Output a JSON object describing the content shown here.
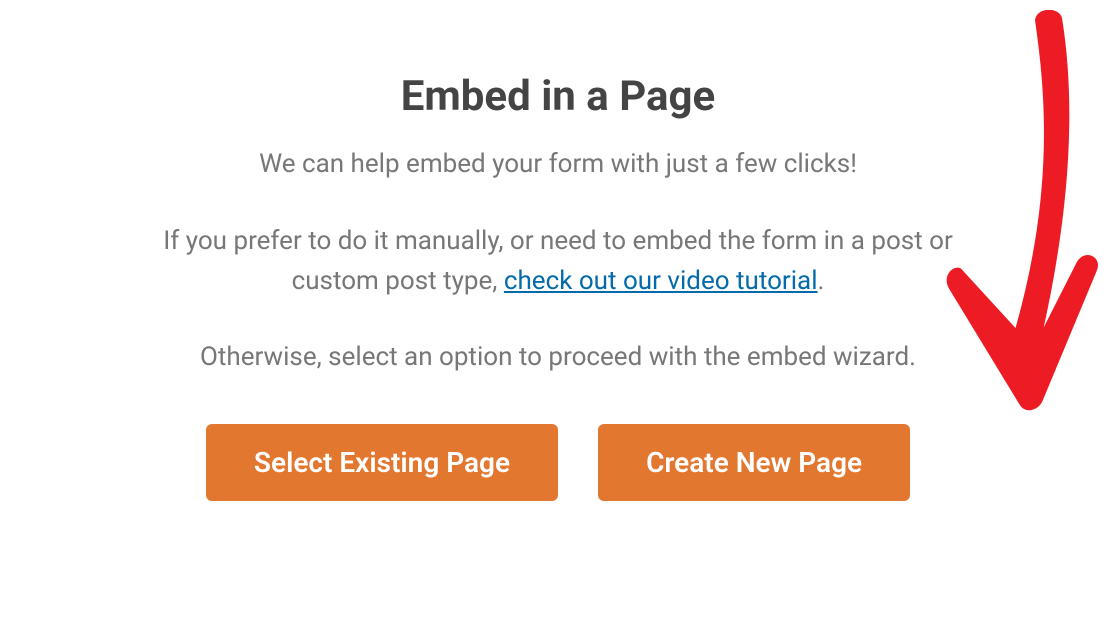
{
  "modal": {
    "title": "Embed in a Page",
    "subtitle": "We can help embed your form with just a few clicks!",
    "description_prefix": "If you prefer to do it manually, or need to embed the form in a post or custom post type, ",
    "description_link": "check out our video tutorial",
    "description_suffix": ".",
    "footer_text": "Otherwise, select an option to proceed with the embed wizard.",
    "buttons": {
      "select_existing": "Select Existing Page",
      "create_new": "Create New Page"
    }
  }
}
